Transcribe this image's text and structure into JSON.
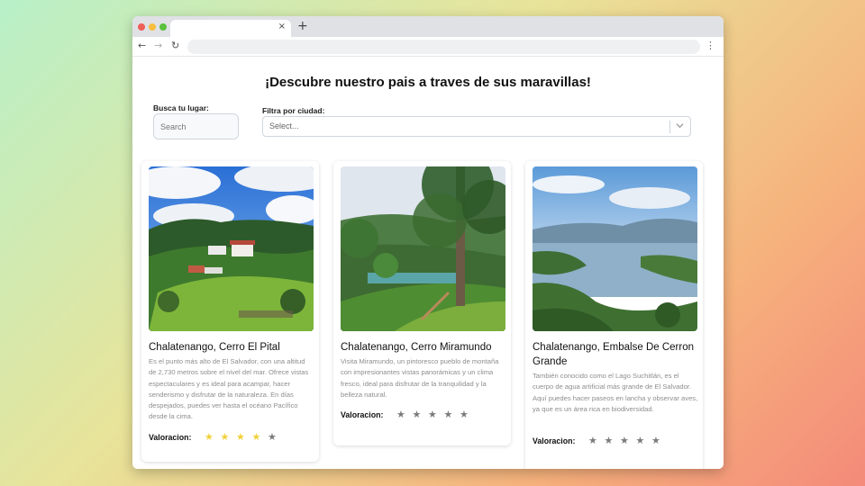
{
  "browser": {
    "tab_close": "×",
    "new_tab": "+",
    "nav_back": "←",
    "nav_forward": "→",
    "nav_reload": "↻",
    "menu": "⋮"
  },
  "page": {
    "title": "¡Descubre nuestro pais a traves de sus maravillas!"
  },
  "filters": {
    "search_label": "Busca tu lugar:",
    "search_placeholder": "Search",
    "city_label": "Filtra por ciudad:",
    "city_placeholder": "Select..."
  },
  "cards": [
    {
      "title": "Chalatenango, Cerro El Pital",
      "description": "Es el punto más alto de El Salvador, con una altitud de 2,730 metros sobre el nivel del mar. Ofrece vistas espectaculares y es ideal para acampar, hacer senderismo y disfrutar de la naturaleza. En días despejados, puedes ver hasta el océano Pacífico desde la cima.",
      "rating_label": "Valoracion:",
      "rating": 4,
      "image_icon": "mountain-landscape-image"
    },
    {
      "title": "Chalatenango, Cerro Miramundo",
      "description": "Visita Miramundo, un pintoresco pueblo de montaña con impresionantes vistas panorámicas y un clima fresco, ideal para disfrutar de la tranquilidad y la belleza natural.",
      "rating_label": "Valoracion:",
      "rating": 0,
      "image_icon": "forest-trail-image"
    },
    {
      "title": "Chalatenango, Embalse De Cerron Grande",
      "description": "También conocido como el Lago Suchitlán, es el cuerpo de agua artificial más grande de El Salvador. Aquí puedes hacer paseos en lancha y observar aves, ya que es un área rica en biodiversidad.",
      "rating_label": "Valoracion:",
      "rating": 0,
      "image_icon": "lake-landscape-image"
    }
  ],
  "colors": {
    "star_active": "#f2d13b",
    "star_inactive": "#7b7b7b"
  }
}
